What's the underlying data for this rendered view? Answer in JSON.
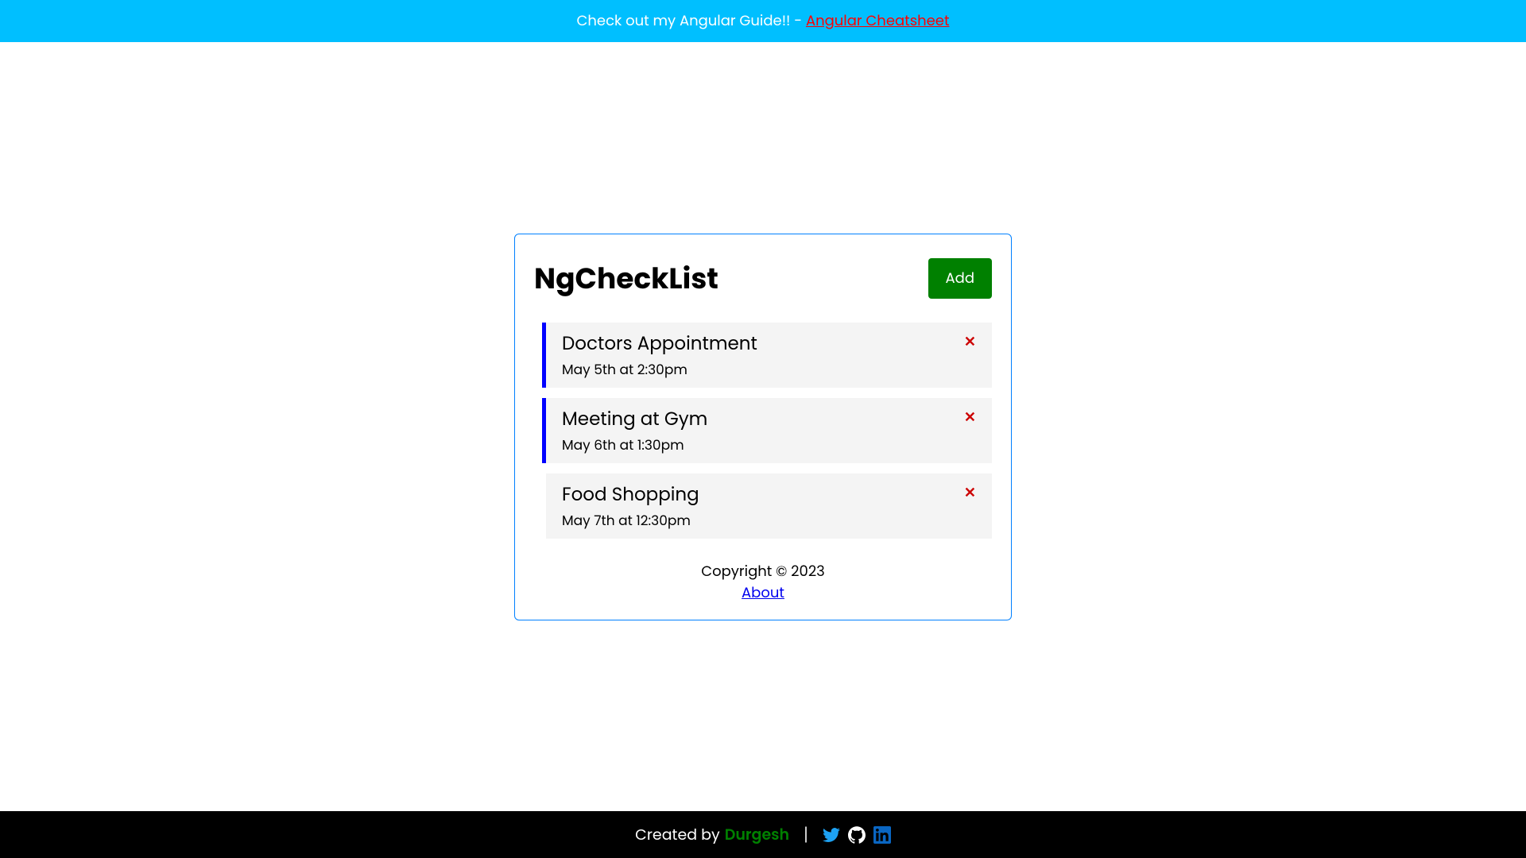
{
  "banner": {
    "text": "Check out my Angular Guide!! - ",
    "link_text": "Angular Cheatsheet"
  },
  "card": {
    "title": "NgCheckList",
    "add_button": "Add"
  },
  "tasks": [
    {
      "title": "Doctors Appointment",
      "date": "May 5th at 2:30pm",
      "reminder": true
    },
    {
      "title": "Meeting at Gym",
      "date": "May 6th at 1:30pm",
      "reminder": true
    },
    {
      "title": "Food Shopping",
      "date": "May 7th at 12:30pm",
      "reminder": false
    }
  ],
  "footer_card": {
    "copyright": "Copyright © 2023",
    "about": "About"
  },
  "page_footer": {
    "created_by": "Created by",
    "author": "Durgesh"
  }
}
